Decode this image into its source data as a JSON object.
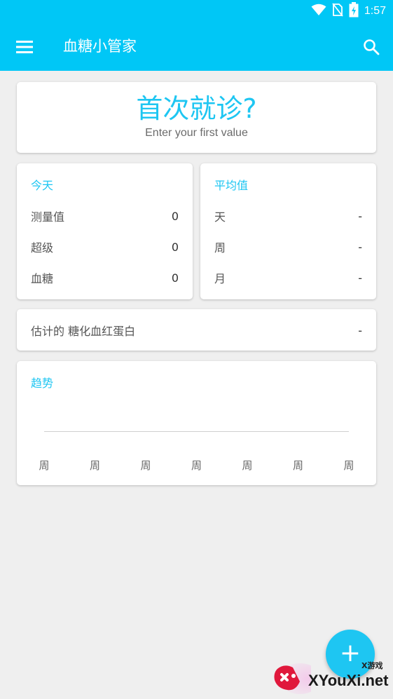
{
  "status_bar": {
    "time": "1:57",
    "icons": [
      "wifi-icon",
      "no-sim-icon",
      "battery-icon"
    ]
  },
  "app_bar": {
    "title": "血糖小管家",
    "menu_icon": "menu-icon",
    "search_icon": "search-icon"
  },
  "first_visit": {
    "title": "首次就诊?",
    "subtitle": "Enter your first value"
  },
  "today": {
    "header": "今天",
    "rows": [
      {
        "label": "测量值",
        "value": "0"
      },
      {
        "label": "超级",
        "value": "0"
      },
      {
        "label": "血糖",
        "value": "0"
      }
    ]
  },
  "average": {
    "header": "平均值",
    "rows": [
      {
        "label": "天",
        "value": "-"
      },
      {
        "label": "周",
        "value": "-"
      },
      {
        "label": "月",
        "value": "-"
      }
    ]
  },
  "hba1c": {
    "label": "估计的 糖化血红蛋白",
    "value": "-"
  },
  "trend": {
    "header": "趋势",
    "x_labels": [
      "周",
      "周",
      "周",
      "周",
      "周",
      "周",
      "周"
    ]
  },
  "fab": {
    "label": "+",
    "icon": "plus-icon"
  },
  "watermark": {
    "text": "XYouXi.net",
    "small": "X游戏"
  },
  "colors": {
    "accent": "#00c7f6",
    "accent_text": "#1ec6f2",
    "background": "#efefef"
  }
}
